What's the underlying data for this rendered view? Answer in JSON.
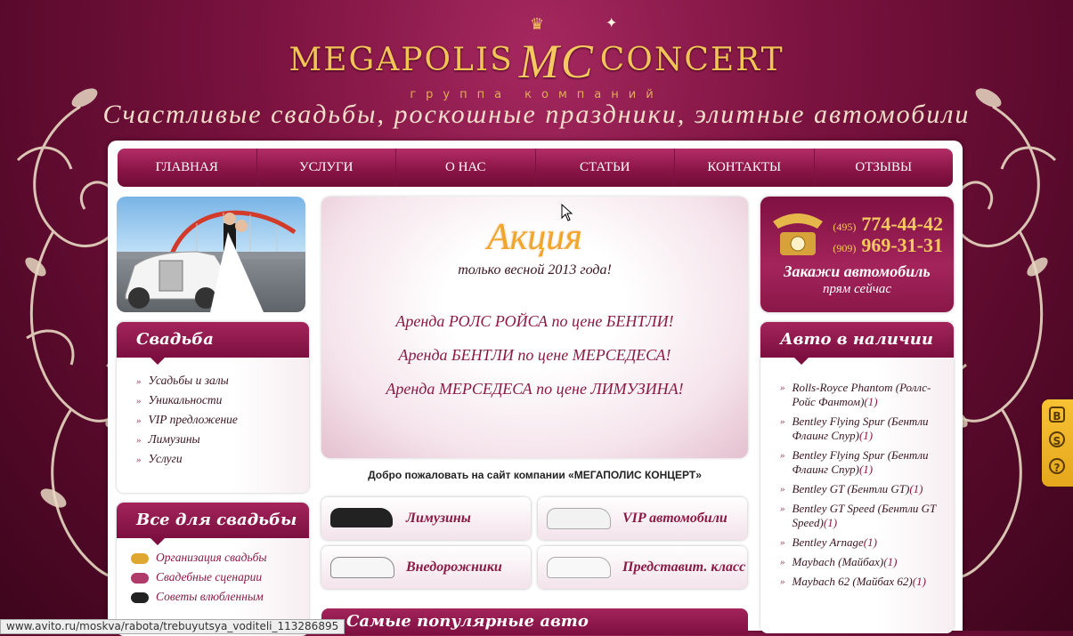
{
  "header": {
    "logo_left": "MEGAPOLIS",
    "logo_mono": "MC",
    "logo_right": "CONCERT",
    "subtitle": "группа компаний",
    "tagline": "Счастливые свадьбы, роскошные праздники, элитные автомобили"
  },
  "nav": [
    "ГЛАВНАЯ",
    "УСЛУГИ",
    "О НАС",
    "СТАТЬИ",
    "КОНТАКТЫ",
    "ОТЗЫВЫ"
  ],
  "wedding_box": {
    "title": "Свадьба",
    "items": [
      "Усадьбы и залы",
      "Уникальности",
      "VIP предложение",
      "Лимузины",
      "Услуги"
    ]
  },
  "all_wedding_box": {
    "title": "Все для свадьбы",
    "items": [
      "Организация свадьбы",
      "Свадебные сценарии",
      "Советы влюбленным"
    ]
  },
  "promo": {
    "title": "Акция",
    "subtitle": "только весной  2013 года!",
    "lines": [
      "Аренда РОЛС РОЙСА по цене БЕНТЛИ!",
      "Аренда БЕНТЛИ по цене МЕРСЕДЕСА!",
      "Аренда МЕРСЕДЕСА по цене ЛИМУЗИНА!"
    ]
  },
  "welcome": "Добро пожаловать на сайт компании «МЕГАПОЛИС КОНЦЕРТ»",
  "categories": [
    "Лимузины",
    "VIP автомобили",
    "Внедорожники",
    "Представит. класс"
  ],
  "popular_title": "Самые популярные авто",
  "phone_box": {
    "code1": "(495)",
    "number1": "774-44-42",
    "code2": "(909)",
    "number2": "969-31-31",
    "cta1": "Закажи автомобиль",
    "cta2": "прям сейчас"
  },
  "auto_box": {
    "title": "Авто в наличии",
    "items": [
      {
        "name": "Rolls-Royce Phantom (Роллс-Ройс Фантом)",
        "count": "(1)"
      },
      {
        "name": "Bentley Flying Spur (Бентли Флаинг Спур)",
        "count": "(1)"
      },
      {
        "name": "Bentley Flying Spur (Бентли Флаинг Спур)",
        "count": "(1)"
      },
      {
        "name": "Bentley GT (Бентли GT)",
        "count": "(1)"
      },
      {
        "name": "Bentley GT Speed (Бентли GT Speed)",
        "count": "(1)"
      },
      {
        "name": "Bentley Arnage",
        "count": "(1)"
      },
      {
        "name": "Maybach (Майбах)",
        "count": "(1)"
      },
      {
        "name": "Maybach 62 (Майбах 62)",
        "count": "(1)"
      }
    ]
  },
  "side_tools": [
    "B",
    "S",
    "?"
  ],
  "status_url": "www.avito.ru/moskva/rabota/trebuyutsya_voditeli_113286895",
  "colors": {
    "brand": "#8a1a44",
    "gold": "#f2c458",
    "accent_orange": "#f2a52c"
  }
}
